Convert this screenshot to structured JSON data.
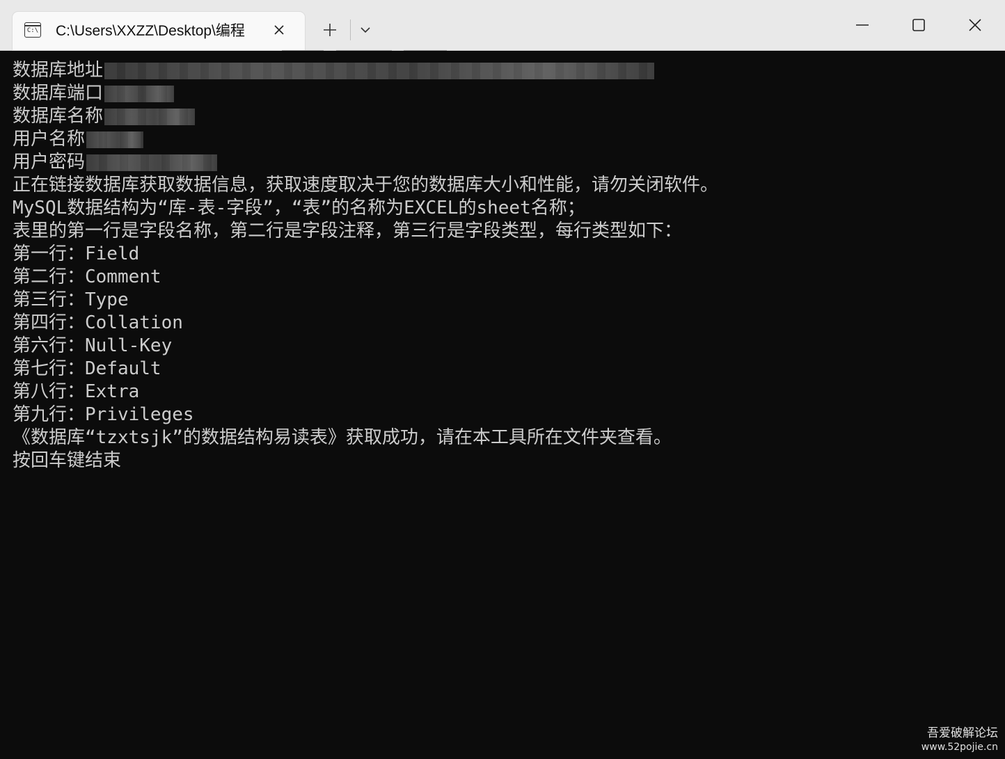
{
  "window": {
    "tab_title": "C:\\Users\\XXZZ\\Desktop\\编程",
    "tab_icon_text": "C:\\"
  },
  "icons": {
    "tab_icon": "terminal-icon",
    "tab_close": "close-icon",
    "new_tab": "plus-icon",
    "dropdown": "chevron-down-icon",
    "minimize": "minimize-icon",
    "maximize": "maximize-icon",
    "close": "close-icon"
  },
  "terminal": {
    "redacted_lines": [
      {
        "label": "数据库地址"
      },
      {
        "label": "数据库端口"
      },
      {
        "label": "数据库名称"
      },
      {
        "label": "用户名称"
      },
      {
        "label": "用户密码"
      }
    ],
    "lines": [
      "正在链接数据库获取数据信息，获取速度取决于您的数据库大小和性能，请勿关闭软件。",
      "MySQL数据结构为“库-表-字段”，“表”的名称为EXCEL的sheet名称；",
      "表里的第一行是字段名称，第二行是字段注释，第三行是字段类型，每行类型如下：",
      "第一行：Field",
      "第二行：Comment",
      "第三行：Type",
      "第四行：Collation",
      "第六行：Null-Key",
      "第七行：Default",
      "第八行：Extra",
      "第九行：Privileges",
      "《数据库“tzxtsjk”的数据结构易读表》获取成功，请在本工具所在文件夹查看。",
      "按回车键结束"
    ]
  },
  "watermark": {
    "name": "吾爱破解论坛",
    "url": "www.52pojie.cn"
  },
  "colors": {
    "terminal_bg": "#0c0c0c",
    "terminal_text": "#cccccc",
    "titlebar_bg": "#e9e9e9",
    "tab_bg": "#f9f9f9"
  }
}
